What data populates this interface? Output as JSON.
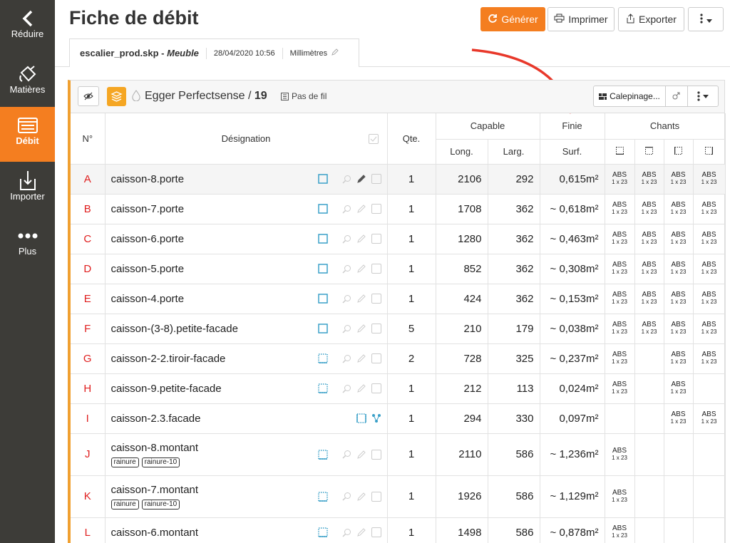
{
  "sidebar": {
    "items": [
      {
        "label": "Réduire",
        "icon": "chevron-left-icon"
      },
      {
        "label": "Matières",
        "icon": "paint-bucket-icon"
      },
      {
        "label": "Débit",
        "icon": "list-icon",
        "active": true
      },
      {
        "label": "Importer",
        "icon": "import-icon"
      },
      {
        "label": "Plus",
        "icon": "more-dots-icon"
      }
    ]
  },
  "header": {
    "title": "Fiche de débit",
    "buttons": {
      "generate": "Générer",
      "print": "Imprimer",
      "export": "Exporter"
    }
  },
  "file": {
    "name": "escalier_prod.skp",
    "separator": " - ",
    "type": "Meuble",
    "date": "28/04/2020 10:56",
    "unit": "Millimètres"
  },
  "toolbar": {
    "material": "Egger Perfectsense",
    "sep": " / ",
    "thickness": "19",
    "grain": "Pas de fil",
    "calepinage": "Calepinage..."
  },
  "table": {
    "headers": {
      "num": "N°",
      "designation": "Désignation",
      "qte": "Qte.",
      "capable": "Capable",
      "finie": "Finie",
      "chants": "Chants",
      "long": "Long.",
      "larg": "Larg.",
      "surf": "Surf."
    },
    "rows": [
      {
        "num": "A",
        "name": "caisson-8.porte",
        "qte": "1",
        "long": "2106",
        "larg": "292",
        "surf": "0,615m²",
        "chants": [
          [
            "ABS",
            "1 x 23"
          ],
          [
            "ABS",
            "1 x 23"
          ],
          [
            "ABS",
            "1 x 23"
          ],
          [
            "ABS",
            "1 x 23"
          ]
        ]
      },
      {
        "num": "B",
        "name": "caisson-7.porte",
        "qte": "1",
        "long": "1708",
        "larg": "362",
        "surf": "~ 0,618m²",
        "chants": [
          [
            "ABS",
            "1 x 23"
          ],
          [
            "ABS",
            "1 x 23"
          ],
          [
            "ABS",
            "1 x 23"
          ],
          [
            "ABS",
            "1 x 23"
          ]
        ]
      },
      {
        "num": "C",
        "name": "caisson-6.porte",
        "qte": "1",
        "long": "1280",
        "larg": "362",
        "surf": "~ 0,463m²",
        "chants": [
          [
            "ABS",
            "1 x 23"
          ],
          [
            "ABS",
            "1 x 23"
          ],
          [
            "ABS",
            "1 x 23"
          ],
          [
            "ABS",
            "1 x 23"
          ]
        ]
      },
      {
        "num": "D",
        "name": "caisson-5.porte",
        "qte": "1",
        "long": "852",
        "larg": "362",
        "surf": "~ 0,308m²",
        "chants": [
          [
            "ABS",
            "1 x 23"
          ],
          [
            "ABS",
            "1 x 23"
          ],
          [
            "ABS",
            "1 x 23"
          ],
          [
            "ABS",
            "1 x 23"
          ]
        ]
      },
      {
        "num": "E",
        "name": "caisson-4.porte",
        "qte": "1",
        "long": "424",
        "larg": "362",
        "surf": "~ 0,153m²",
        "chants": [
          [
            "ABS",
            "1 x 23"
          ],
          [
            "ABS",
            "1 x 23"
          ],
          [
            "ABS",
            "1 x 23"
          ],
          [
            "ABS",
            "1 x 23"
          ]
        ]
      },
      {
        "num": "F",
        "name": "caisson-(3-8).petite-facade",
        "qte": "5",
        "long": "210",
        "larg": "179",
        "surf": "~ 0,038m²",
        "chants": [
          [
            "ABS",
            "1 x 23"
          ],
          [
            "ABS",
            "1 x 23"
          ],
          [
            "ABS",
            "1 x 23"
          ],
          [
            "ABS",
            "1 x 23"
          ]
        ]
      },
      {
        "num": "G",
        "name": "caisson-2-2.tiroir-facade",
        "qte": "2",
        "long": "728",
        "larg": "325",
        "surf": "~ 0,237m²",
        "chants": [
          [
            "ABS",
            "1 x 23"
          ],
          [
            "",
            ""
          ],
          [
            "ABS",
            "1 x 23"
          ],
          [
            "ABS",
            "1 x 23"
          ]
        ]
      },
      {
        "num": "H",
        "name": "caisson-9.petite-facade",
        "qte": "1",
        "long": "212",
        "larg": "113",
        "surf": "0,024m²",
        "chants": [
          [
            "ABS",
            "1 x 23"
          ],
          [
            "",
            ""
          ],
          [
            "ABS",
            "1 x 23"
          ],
          [
            "",
            ""
          ]
        ]
      },
      {
        "num": "I",
        "name": "caisson-2.3.facade",
        "qte": "1",
        "long": "294",
        "larg": "330",
        "surf": "0,097m²",
        "chants": [
          [
            "",
            ""
          ],
          [
            "",
            ""
          ],
          [
            "ABS",
            "1 x 23"
          ],
          [
            "ABS",
            "1 x 23"
          ]
        ]
      },
      {
        "num": "J",
        "name": "caisson-8.montant",
        "qte": "1",
        "long": "2110",
        "larg": "586",
        "surf": "~ 1,236m²",
        "tags": [
          "rainure",
          "rainure-10"
        ],
        "chants": [
          [
            "ABS",
            "1 x 23"
          ],
          [
            "",
            ""
          ],
          [
            "",
            ""
          ],
          [
            "",
            ""
          ]
        ]
      },
      {
        "num": "K",
        "name": "caisson-7.montant",
        "qte": "1",
        "long": "1926",
        "larg": "586",
        "surf": "~ 1,129m²",
        "tags": [
          "rainure",
          "rainure-10"
        ],
        "chants": [
          [
            "ABS",
            "1 x 23"
          ],
          [
            "",
            ""
          ],
          [
            "",
            ""
          ],
          [
            "",
            ""
          ]
        ]
      },
      {
        "num": "L",
        "name": "caisson-6.montant",
        "qte": "1",
        "long": "1498",
        "larg": "586",
        "surf": "~ 0,878m²",
        "chants": [
          [
            "ABS",
            "1 x 23"
          ],
          [
            "",
            ""
          ],
          [
            "",
            ""
          ],
          [
            "",
            ""
          ]
        ]
      }
    ]
  },
  "colors": {
    "accent": "#f47e20",
    "sidebar": "#3d3c38",
    "letter": "#e02020",
    "icon": "#3aa0c8",
    "arrow": "#e8382a"
  }
}
